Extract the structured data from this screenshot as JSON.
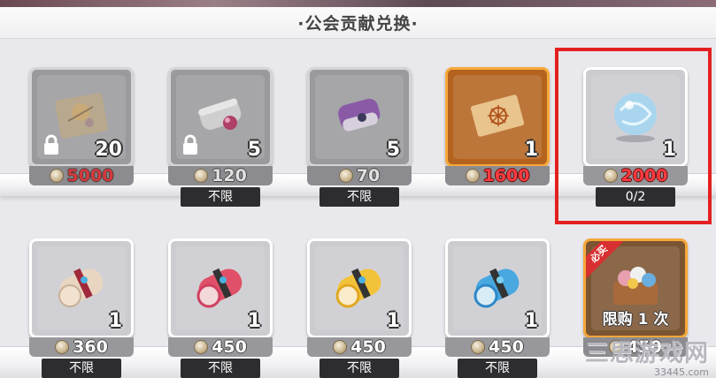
{
  "header": {
    "title": "·公会贡献兑换·"
  },
  "colors": {
    "highlight": "#e32020",
    "price_red": "#ff3b40",
    "gold_frame": "#f6a93b"
  },
  "rows": [
    {
      "items": [
        {
          "icon": "treasure-map-icon",
          "qty": "20",
          "price": "5000",
          "locked": true,
          "limit": ""
        },
        {
          "icon": "scroll-with-gem-icon",
          "qty": "5",
          "price": "120",
          "locked": true,
          "limit": "不限"
        },
        {
          "icon": "purple-scroll-icon",
          "qty": "5",
          "price": "70",
          "locked": true,
          "limit": "不限"
        },
        {
          "icon": "golden-ticket-icon",
          "qty": "1",
          "price": "1600",
          "locked": false,
          "limit": ""
        },
        {
          "icon": "crystal-orb-icon",
          "qty": "1",
          "price": "2000",
          "locked": false,
          "limit": "0/2"
        }
      ]
    },
    {
      "items": [
        {
          "icon": "white-scroll-icon",
          "qty": "1",
          "price": "360",
          "limit": "不限"
        },
        {
          "icon": "red-scroll-icon",
          "qty": "1",
          "price": "450",
          "limit": "不限"
        },
        {
          "icon": "yellow-scroll-icon",
          "qty": "1",
          "price": "450",
          "limit": "不限"
        },
        {
          "icon": "blue-scroll-icon",
          "qty": "1",
          "price": "450",
          "limit": "不限"
        },
        {
          "icon": "treasure-chest-icon",
          "badge": "必买",
          "label": "限购 1 次",
          "price": "450",
          "limit": ""
        }
      ]
    }
  ],
  "watermark": {
    "main": "三思游戏网",
    "sub": "33445.com"
  }
}
